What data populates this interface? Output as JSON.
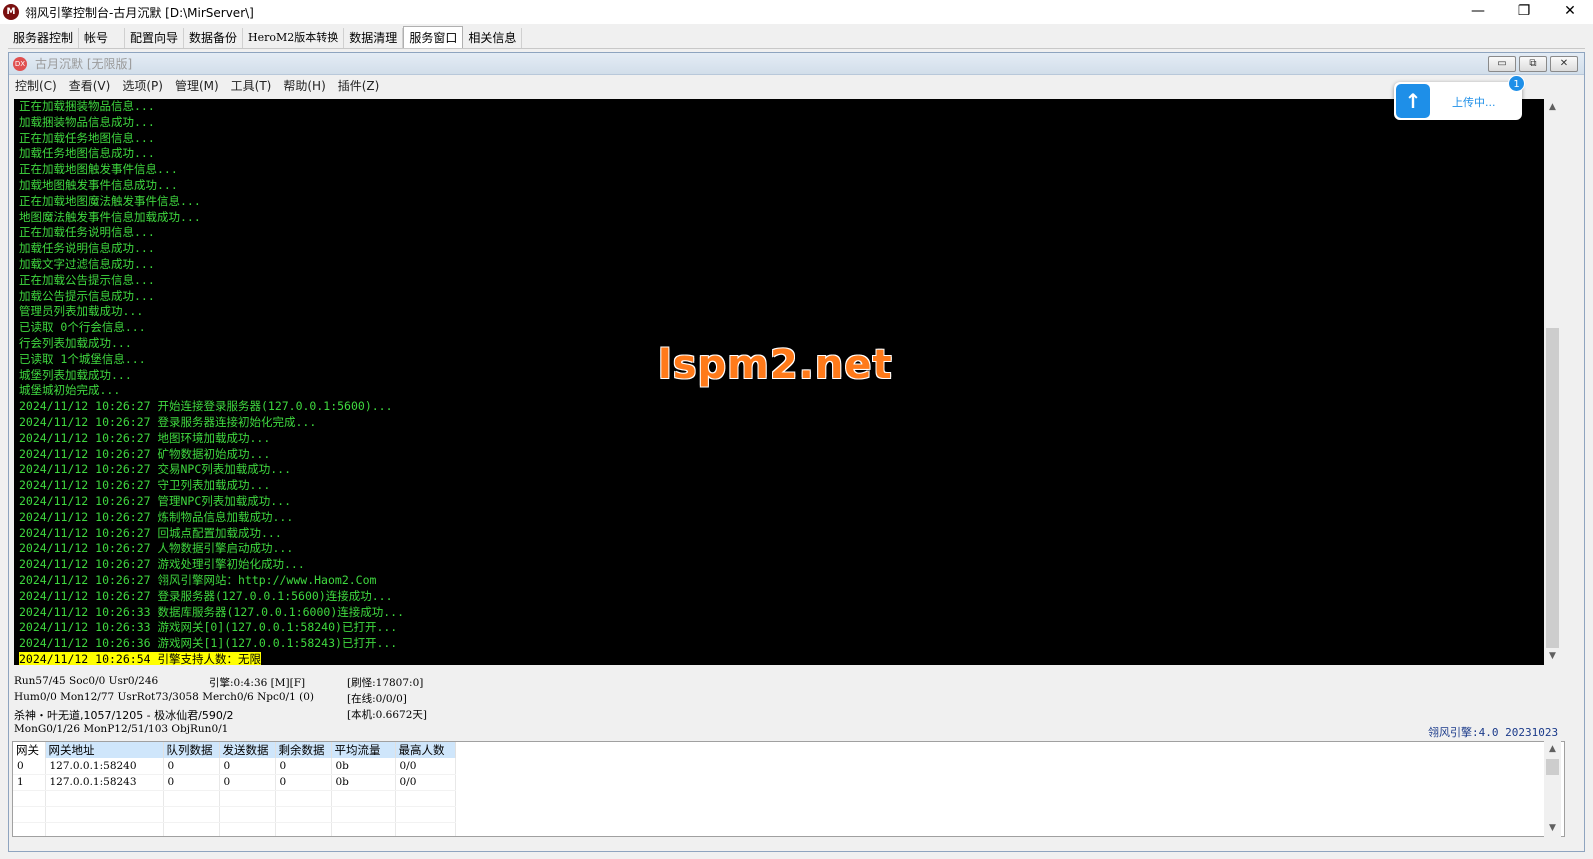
{
  "window": {
    "title": "翎风引擎控制台-古月沉默 [D:\\MirServer\\]",
    "icon_text": "M",
    "minimize": "—",
    "maximize": "❐",
    "close": "✕"
  },
  "top_tabs": [
    "服务器控制",
    "帐号",
    "配置向导",
    "数据备份",
    "HeroM2版本转换",
    "数据清理",
    "服务窗口",
    "相关信息"
  ],
  "active_tab_index": 6,
  "inner_window": {
    "title": "古月沉默 [无限版]",
    "icon_text": "DX",
    "btn_min": "▭",
    "btn_restore": "⧉",
    "btn_close": "✕"
  },
  "menu": [
    "控制(C)",
    "查看(V)",
    "选项(P)",
    "管理(M)",
    "工具(T)",
    "帮助(H)",
    "插件(Z)"
  ],
  "console_lines": [
    "正在加载捆装物品信息...",
    "加载捆装物品信息成功...",
    "正在加载任务地图信息...",
    "加载任务地图信息成功...",
    "正在加载地图触发事件信息...",
    "加载地图触发事件信息成功...",
    "正在加载地图魔法触发事件信息...",
    "地图魔法触发事件信息加载成功...",
    "正在加载任务说明信息...",
    "加载任务说明信息成功...",
    "加载文字过滤信息成功...",
    "正在加载公告提示信息...",
    "加载公告提示信息成功...",
    "管理员列表加载成功...",
    "已读取 0个行会信息...",
    "行会列表加载成功...",
    "已读取 1个城堡信息...",
    "城堡列表加载成功...",
    "城堡城初始完成...",
    "2024/11/12 10:26:27 开始连接登录服务器(127.0.0.1:5600)...",
    "2024/11/12 10:26:27 登录服务器连接初始化完成...",
    "2024/11/12 10:26:27 地图环境加载成功...",
    "2024/11/12 10:26:27 矿物数据初始成功...",
    "2024/11/12 10:26:27 交易NPC列表加载成功...",
    "2024/11/12 10:26:27 守卫列表加载成功...",
    "2024/11/12 10:26:27 管理NPC列表加载成功...",
    "2024/11/12 10:26:27 炼制物品信息加载成功...",
    "2024/11/12 10:26:27 回城点配置加载成功...",
    "2024/11/12 10:26:27 人物数据引擎启动成功...",
    "2024/11/12 10:26:27 游戏处理引擎初始化成功...",
    "2024/11/12 10:26:27 翎风引擎网站：http://www.Haom2.Com",
    "2024/11/12 10:26:27 登录服务器(127.0.0.1:5600)连接成功...",
    "2024/11/12 10:26:33 数据库服务器(127.0.0.1:6000)连接成功...",
    "2024/11/12 10:26:33 游戏网关[0](127.0.0.1:58240)已打开...",
    "2024/11/12 10:26:36 游戏网关[1](127.0.0.1:58243)已打开..."
  ],
  "console_highlight_line": "2024/11/12 10:26:54 引擎支持人数：无限",
  "console_scroll": {
    "up": "▲",
    "down": "▼"
  },
  "watermark": "lspm2.net",
  "upload": {
    "text": "上传中...",
    "badge": "1",
    "arrow": "↑"
  },
  "status": {
    "line1a": "Run57/45 Soc0/0 Usr0/246",
    "line1b": "引擎:0:4:36 [M][F]",
    "line1c": "[刷怪:17807:0]",
    "line2a": "Hum0/0 Mon12/77 UsrRot73/3058 Merch0/6 Npc0/1 (0)",
    "line2b": "[在线:0/0/0]",
    "line3a": "杀神・叶无道,1057/1205 - 极冰仙君/590/2",
    "line3b": "[本机:0.6672天]",
    "line4a": "MonG0/1/26 MonP12/51/103 ObjRun0/1",
    "engine_version": "翎风引擎:4.0 20231023"
  },
  "gateway_table": {
    "headers": [
      "网关",
      "网关地址",
      "队列数据",
      "发送数据",
      "剩余数据",
      "平均流量",
      "最高人数"
    ],
    "rows": [
      [
        "0",
        "127.0.0.1:58240",
        "0",
        "0",
        "0",
        "0b",
        "0/0"
      ],
      [
        "1",
        "127.0.0.1:58243",
        "0",
        "0",
        "0",
        "0b",
        "0/0"
      ],
      [
        "",
        "",
        "",
        "",
        "",
        "",
        ""
      ],
      [
        "",
        "",
        "",
        "",
        "",
        "",
        ""
      ],
      [
        "",
        "",
        "",
        "",
        "",
        "",
        ""
      ]
    ]
  },
  "colors": {
    "console_text": "#3fd83f",
    "console_bg": "#000000",
    "highlight_bg": "#ffff00",
    "header_bg": "#cfe6fb",
    "accent_blue": "#1e8fe8",
    "watermark": "#ff7a1a"
  }
}
